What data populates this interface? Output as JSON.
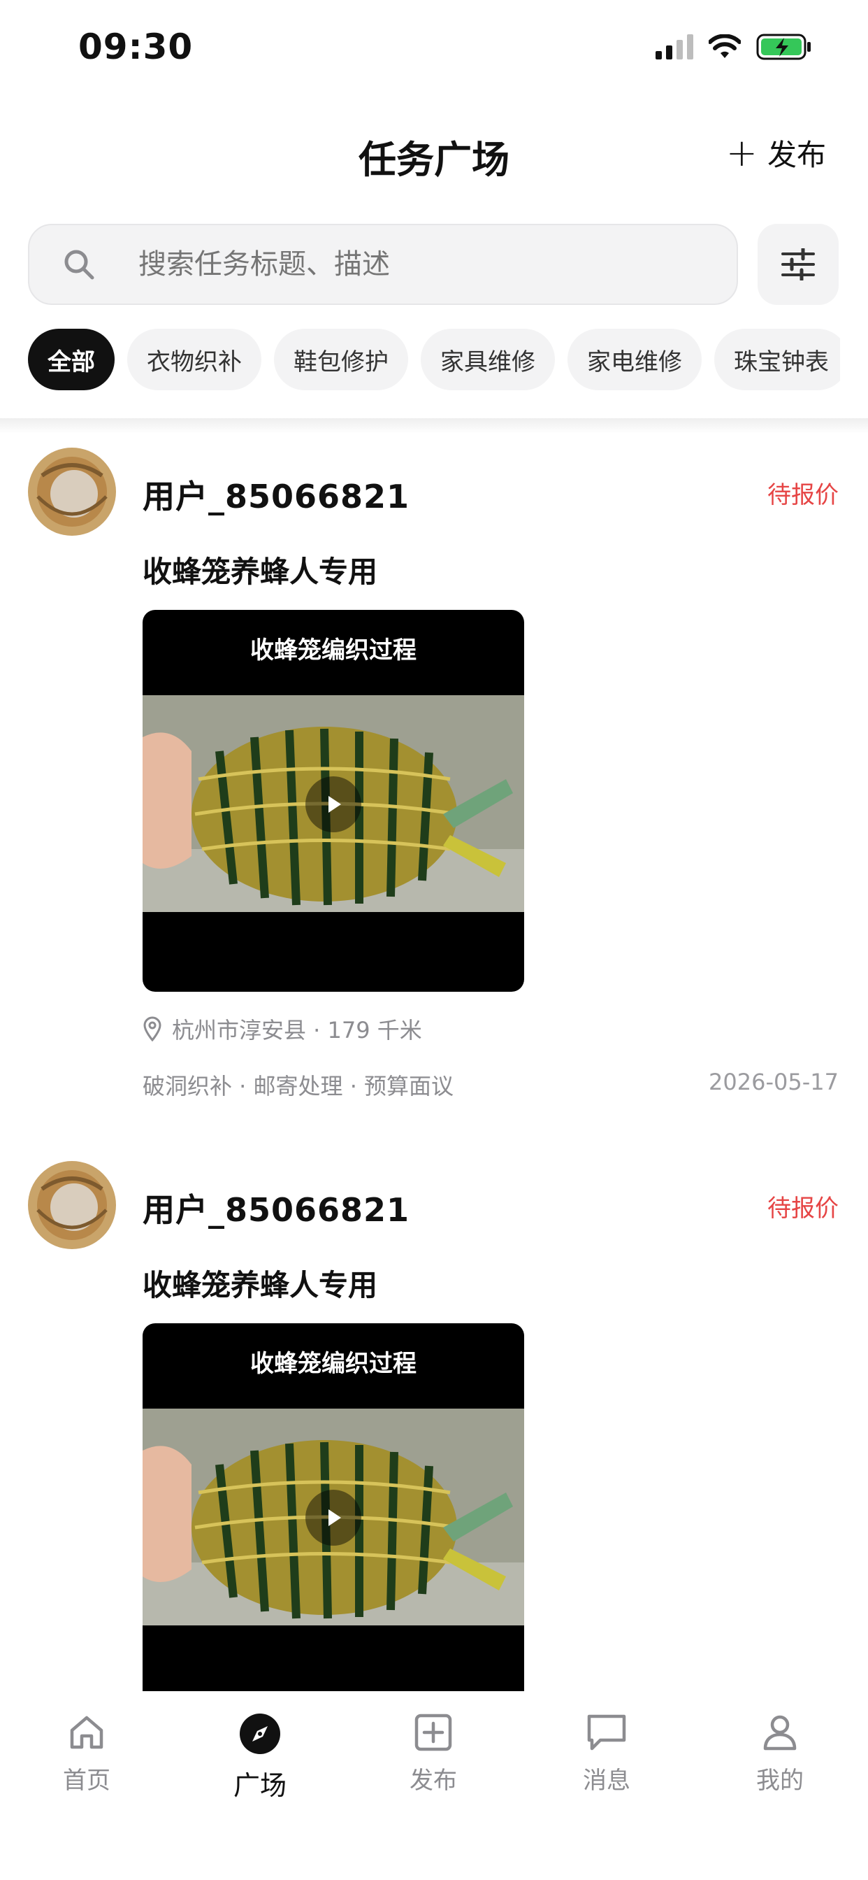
{
  "status_bar": {
    "time": "09:30"
  },
  "header": {
    "title": "任务广场",
    "publish_label": "发布"
  },
  "search": {
    "placeholder": "搜索任务标题、描述"
  },
  "categories": [
    "全部",
    "衣物织补",
    "鞋包修护",
    "家具维修",
    "家电维修",
    "珠宝钟表"
  ],
  "active_category": "全部",
  "feed": [
    {
      "username": "用户_85066821",
      "status": "待报价",
      "title": "收蜂笼养蜂人专用",
      "video_caption": "收蜂笼编织过程",
      "location": "杭州市淳安县 · 179 千米",
      "meta": "破洞织补 · 邮寄处理 · 预算面议",
      "date": "2026-05-17"
    },
    {
      "username": "用户_85066821",
      "status": "待报价",
      "title": "收蜂笼养蜂人专用",
      "video_caption": "收蜂笼编织过程"
    }
  ],
  "tabbar": {
    "items": [
      {
        "label": "首页",
        "icon": "home-icon"
      },
      {
        "label": "广场",
        "icon": "compass-icon"
      },
      {
        "label": "发布",
        "icon": "plus-square-icon"
      },
      {
        "label": "消息",
        "icon": "message-icon"
      },
      {
        "label": "我的",
        "icon": "user-icon"
      }
    ],
    "active": "广场"
  },
  "colors": {
    "status_red": "#e64545",
    "active_chip": "#111111",
    "chip_bg": "#f3f3f4",
    "battery_green": "#35c759"
  }
}
